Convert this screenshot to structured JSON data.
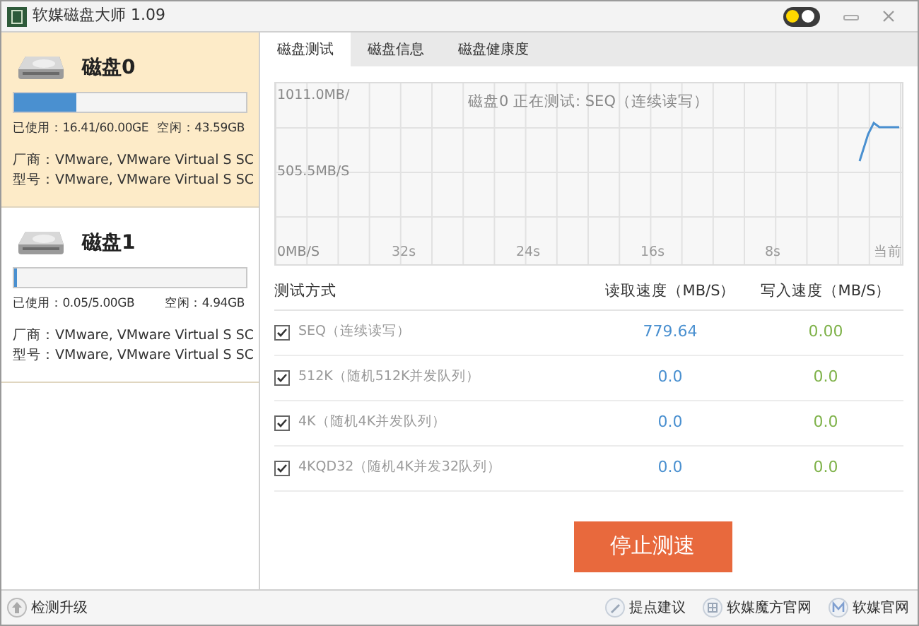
{
  "window": {
    "title": "软媒磁盘大师 1.09",
    "toggle": {
      "on": true
    }
  },
  "disks": [
    {
      "name": "磁盘0",
      "selected": true,
      "level": 0.27,
      "used": "已使用：16.41/60.00GE",
      "free": "空闲：43.59GB",
      "vendor": "厂商：VMware, VMware Virtual S SC",
      "model": "型号：VMware, VMware Virtual S SC"
    },
    {
      "name": "磁盘1",
      "selected": false,
      "level": 0.01,
      "used": "已使用：0.05/5.00GB",
      "free": "空闲：4.94GB",
      "vendor": "厂商：VMware, VMware Virtual S SC",
      "model": "型号：VMware, VMware Virtual S SC"
    }
  ],
  "tabs": [
    {
      "label": "磁盘测试",
      "selected": true
    },
    {
      "label": "磁盘信息",
      "selected": false
    },
    {
      "label": "磁盘健康度",
      "selected": false
    }
  ],
  "chart": {
    "title": "磁盘0 正在测试: SEQ（连续读写）",
    "y_labels": [
      "1011.0MB/",
      "505.5MB/S",
      "0MB/S"
    ],
    "x_labels": [
      "32s",
      "24s",
      "16s",
      "8s",
      "当前"
    ]
  },
  "table": {
    "columns": [
      "测试方式",
      "读取速度（MB/S）",
      "写入速度（MB/S）"
    ],
    "rows": [
      {
        "checked": true,
        "name": "SEQ（连续读写）",
        "read": "779.64",
        "write": "0.00"
      },
      {
        "checked": true,
        "name": "512K（随机512K并发队列）",
        "read": "0.0",
        "write": "0.0"
      },
      {
        "checked": true,
        "name": "4K（随机4K并发队列）",
        "read": "0.0",
        "write": "0.0"
      },
      {
        "checked": true,
        "name": "4KQD32（随机4K并发32队列）",
        "read": "0.0",
        "write": "0.0"
      }
    ]
  },
  "stop_button": "停止测速",
  "status_bar": {
    "update": "检测升级",
    "links": [
      {
        "kind": "pencil",
        "label": "提点建议"
      },
      {
        "kind": "grid",
        "label": "软媒魔方官网"
      },
      {
        "kind": "m",
        "label": "软媒官网"
      }
    ]
  }
}
